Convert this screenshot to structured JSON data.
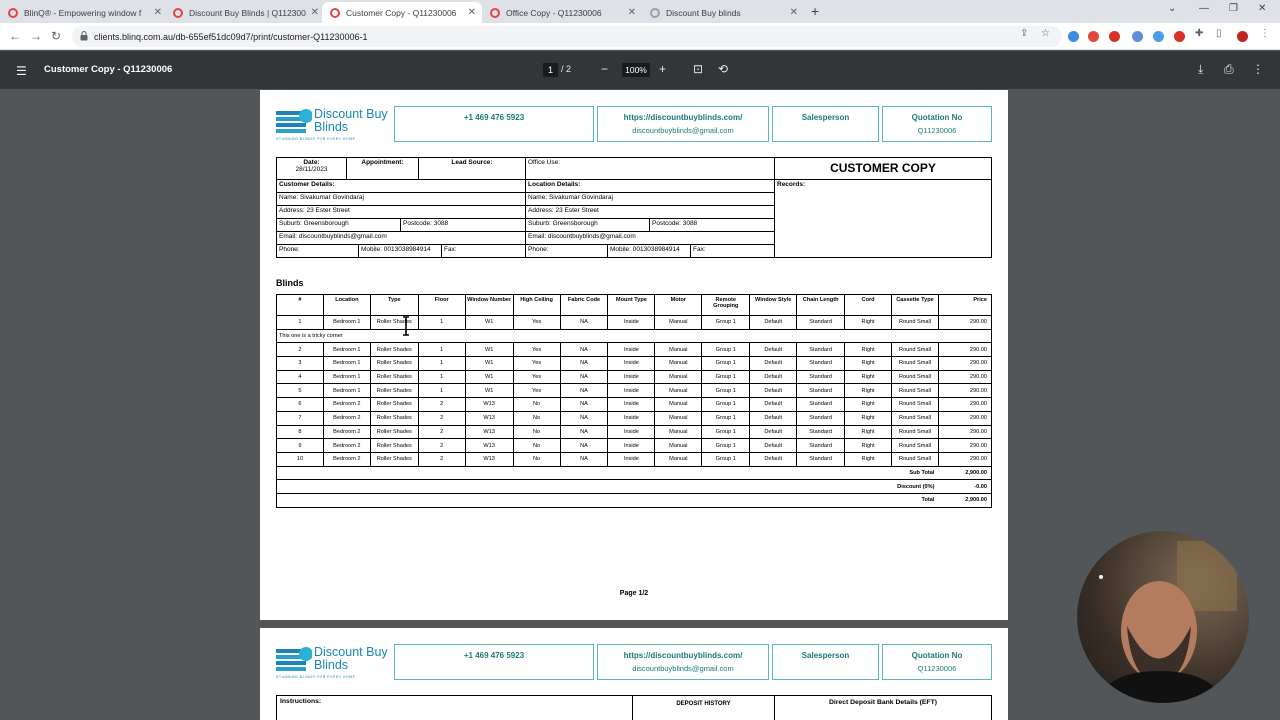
{
  "browser": {
    "tabs": [
      {
        "label": "BlinQ® - Empowering window f",
        "icon_color": "#e04545",
        "active": false
      },
      {
        "label": "Discount Buy Blinds | Q112300",
        "icon_color": "#e04545",
        "active": false
      },
      {
        "label": "Customer Copy - Q11230006",
        "icon_color": "#e04545",
        "active": true
      },
      {
        "label": "Office Copy - Q11230006",
        "icon_color": "#e04545",
        "active": false
      },
      {
        "label": "Discount Buy blinds",
        "icon_color": "#9aa0a6",
        "active": false
      }
    ],
    "url": "clients.blinq.com.au/db-655ef51dc09d7/print/customer-Q11230006-1"
  },
  "viewer": {
    "title": "Customer Copy - Q11230006",
    "current_page": "1",
    "total_pages": "/  2",
    "zoom": "100%"
  },
  "document": {
    "logo": {
      "line1": "Discount Buy",
      "line2": "Blinds",
      "tagline": "STUNNING BLINDS FOR EVERY HOME"
    },
    "phone": "+1 469 476 5923",
    "website": "https://discountbuyblinds.com/",
    "email": "discountbuyblinds@gmail.com",
    "salesperson_label": "Salesperson",
    "quotation_label": "Quotation No",
    "quotation_no": "Q11230006",
    "date_label": "Date:",
    "date": "28/11/2023",
    "appointment_label": "Appointment:",
    "lead_source_label": "Lead Source:",
    "office_use_label": "Office Use:",
    "copy_title": "CUSTOMER COPY",
    "records_label": "Records:",
    "customer_details_label": "Customer Details:",
    "location_details_label": "Location Details:",
    "customer": {
      "name": "Name: Sivakumar Govindaraj",
      "address": "Address: 23 Ester Street",
      "suburb": "Suburb: Greensborough",
      "postcode": "Postcode: 3088",
      "email": "Email: discountbuyblinds@gmail.com",
      "phone": "Phone:",
      "mobile": "Mobile: 0013038984914",
      "fax": "Fax:"
    },
    "location": {
      "name": "Name: Sivakumar Govindaraj",
      "address": "Address: 23 Ester Street",
      "suburb": "Suburb: Greensborough",
      "postcode": "Postcode: 3088",
      "email": "Email: discountbuyblinds@gmail.com",
      "phone": "Phone:",
      "mobile": "Mobile: 0013038984914",
      "fax": "Fax:"
    },
    "section_title": "Blinds",
    "columns": [
      "#",
      "Location",
      "Type",
      "Floor",
      "Window Number",
      "High Ceiling",
      "Fabric Code",
      "Mount Type",
      "Motor",
      "Remote Grouping",
      "Window Style",
      "Chain Length",
      "Cord",
      "Cassette Type",
      "Price"
    ],
    "rows": [
      [
        "1",
        "Bedroom 1",
        "Roller Shades",
        "1",
        "W1",
        "Yes",
        "NA",
        "Inside",
        "Manual",
        "Group 1",
        "Default",
        "Standard",
        "Right",
        "Round Small",
        "290.00"
      ],
      [
        "2",
        "Bedroom 1",
        "Roller Shades",
        "1",
        "W1",
        "Yes",
        "NA",
        "Inside",
        "Manual",
        "Group 1",
        "Default",
        "Standard",
        "Right",
        "Round Small",
        "290.00"
      ],
      [
        "3",
        "Bedroom 1",
        "Roller Shades",
        "1",
        "W1",
        "Yes",
        "NA",
        "Inside",
        "Manual",
        "Group 1",
        "Default",
        "Standard",
        "Right",
        "Round Small",
        "290.00"
      ],
      [
        "4",
        "Bedroom 1",
        "Roller Shades",
        "1",
        "W1",
        "Yes",
        "NA",
        "Inside",
        "Manual",
        "Group 1",
        "Default",
        "Standard",
        "Right",
        "Round Small",
        "290.00"
      ],
      [
        "5",
        "Bedroom 1",
        "Roller Shades",
        "1",
        "W1",
        "Yes",
        "NA",
        "Inside",
        "Manual",
        "Group 1",
        "Default",
        "Standard",
        "Right",
        "Round Small",
        "290.00"
      ],
      [
        "6",
        "Bedroom 2",
        "Roller Shades",
        "2",
        "W13",
        "No",
        "NA",
        "Inside",
        "Manual",
        "Group 1",
        "Default",
        "Standard",
        "Right",
        "Round Small",
        "290.00"
      ],
      [
        "7",
        "Bedroom 2",
        "Roller Shades",
        "2",
        "W13",
        "No",
        "NA",
        "Inside",
        "Manual",
        "Group 1",
        "Default",
        "Standard",
        "Right",
        "Round Small",
        "290.00"
      ],
      [
        "8",
        "Bedroom 2",
        "Roller Shades",
        "2",
        "W13",
        "No",
        "NA",
        "Inside",
        "Manual",
        "Group 1",
        "Default",
        "Standard",
        "Right",
        "Round Small",
        "290.00"
      ],
      [
        "9",
        "Bedroom 2",
        "Roller Shades",
        "2",
        "W13",
        "No",
        "NA",
        "Inside",
        "Manual",
        "Group 1",
        "Default",
        "Standard",
        "Right",
        "Round Small",
        "290.00"
      ],
      [
        "10",
        "Bedroom 2",
        "Roller Shades",
        "2",
        "W13",
        "No",
        "NA",
        "Inside",
        "Manual",
        "Group 1",
        "Default",
        "Standard",
        "Right",
        "Round Small",
        "290.00"
      ]
    ],
    "row1_note": "This one is a tricky corner",
    "subtotal_label": "Sub Total",
    "subtotal": "2,900.00",
    "discount_label": "Discount (0%)",
    "discount": "-0.00",
    "total_label": "Total",
    "total": "2,900.00",
    "page_footer": "Page 1/2",
    "p2": {
      "instructions_label": "Instructions:",
      "deposit_history_label": "DEPOSIT HISTORY",
      "bank_details_label": "Direct Deposit Bank Details (EFT)"
    }
  },
  "icons": {
    "menu": "hamburger-icon",
    "download": "download-icon",
    "print": "print-icon",
    "more": "more-vert-icon"
  },
  "colors": {
    "teal": "#1a7a7a",
    "brand_blue": "#1a86b8",
    "viewer_bg": "#525659",
    "viewer_bar": "#323639"
  }
}
